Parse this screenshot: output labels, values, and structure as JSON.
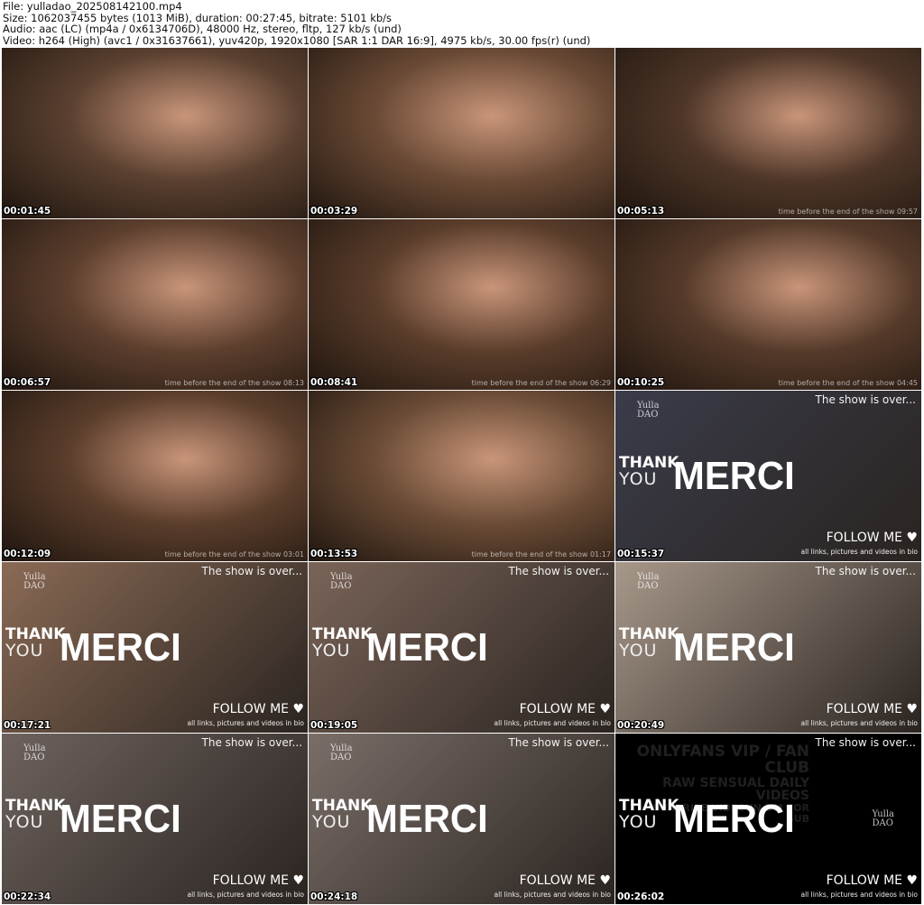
{
  "header": {
    "lines": [
      "File: yulladao_202508142100.mp4",
      "Size: 1062037455 bytes (1013 MiB), duration: 00:27:45, bitrate: 5101 kb/s",
      "Audio: aac (LC) (mp4a / 0x6134706D), 48000 Hz, stereo, fltp, 127 kb/s (und)",
      "Video: h264 (High) (avc1 / 0x31637661), yuv420p, 1920x1080 [SAR 1:1 DAR 16:9], 4975 kb/s, 30.00 fps(r) (und)"
    ]
  },
  "overlay": {
    "countdown_prefix": "time before the end of the show",
    "show_over": "The show is over...",
    "thank": "THANK",
    "you": "YOU",
    "merci": "MERCI",
    "follow": "FOLLOW ME ♥",
    "bio": "all links, pictures and videos in bio",
    "logo_top": "Yulla",
    "logo_bottom": "DAO",
    "of_lines": [
      "ONLYFANS VIP / FAN CLUB",
      "RAW SENSUAL DAILY VIDEOS",
      "SURPRISE VIDEO IN DM FOR SUB"
    ]
  },
  "thumbnails": [
    {
      "time": "00:01:45",
      "kind": "live",
      "bg": "#5a4030"
    },
    {
      "time": "00:03:29",
      "kind": "live",
      "bg": "#6a4a35"
    },
    {
      "time": "00:05:13",
      "kind": "live",
      "bg": "#4e3628",
      "countdown": "09:57"
    },
    {
      "time": "00:06:57",
      "kind": "live",
      "bg": "#5d3f2e",
      "countdown": "08:13"
    },
    {
      "time": "00:08:41",
      "kind": "live",
      "bg": "#5a3d2b",
      "countdown": "06:29"
    },
    {
      "time": "00:10:25",
      "kind": "live",
      "bg": "#553a2a",
      "countdown": "04:45"
    },
    {
      "time": "00:12:09",
      "kind": "live",
      "bg": "#5b3e2c",
      "countdown": "03:01"
    },
    {
      "time": "00:13:53",
      "kind": "live",
      "bg": "#6b4c36",
      "countdown": "01:17"
    },
    {
      "time": "00:15:37",
      "kind": "end",
      "bg": "#3a3c4a"
    },
    {
      "time": "00:17:21",
      "kind": "end",
      "bg": "#8a6a55"
    },
    {
      "time": "00:19:05",
      "kind": "end",
      "bg": "#7a6458"
    },
    {
      "time": "00:20:49",
      "kind": "end",
      "bg": "#a8988a"
    },
    {
      "time": "00:22:34",
      "kind": "end",
      "bg": "#6d625e"
    },
    {
      "time": "00:24:18",
      "kind": "end",
      "bg": "#7a6e68"
    },
    {
      "time": "00:26:02",
      "kind": "end_of",
      "bg": "#000000"
    }
  ]
}
